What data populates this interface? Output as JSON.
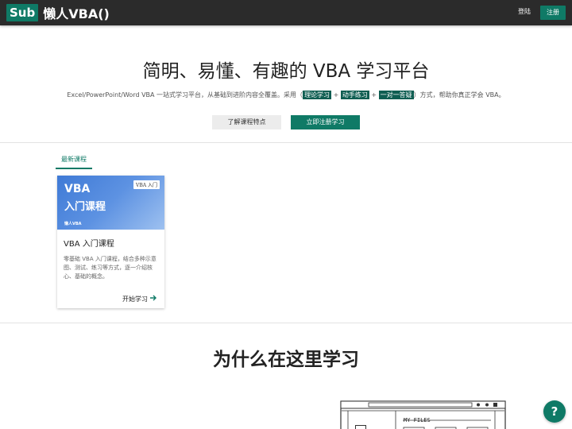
{
  "nav": {
    "logo_badge": "Sub",
    "logo_text": "懒人VBA()",
    "login": "登陆",
    "register": "注册"
  },
  "hero": {
    "title": "简明、易懂、有趣的 VBA 学习平台",
    "subtitle_pre": "Excel/PowerPoint/Word VBA 一站式学习平台，从基础到进阶内容全覆盖。采用（",
    "tag1": "理论学习",
    "plus1": " + ",
    "tag2": "动手练习",
    "plus2": " + ",
    "tag3": "一对一答疑",
    "subtitle_post": "）方式，帮助你真正学会 VBA。",
    "btn_learn": "了解课程特点",
    "btn_join": "立即注册学习"
  },
  "courses": {
    "tab_label": "最新课程",
    "items": [
      {
        "banner_line1": "VBA",
        "banner_line2": "入门课程",
        "banner_badge": "VBA 入门",
        "banner_brand": "懒人VBA",
        "title": "VBA 入门课程",
        "description": "零基础 VBA 入门课程，结合多种示意图、测试、练习等方式，逐一介绍核心、基础的概念。",
        "action": "开始学习"
      }
    ]
  },
  "why": {
    "title": "为什么在这里学习"
  },
  "illustration": {
    "label": "MY FILES"
  },
  "help": {
    "label": "?"
  },
  "colors": {
    "accent": "#0f7a66",
    "topbar": "#2b2b2b",
    "banner_blue": "#3f7ad6"
  }
}
